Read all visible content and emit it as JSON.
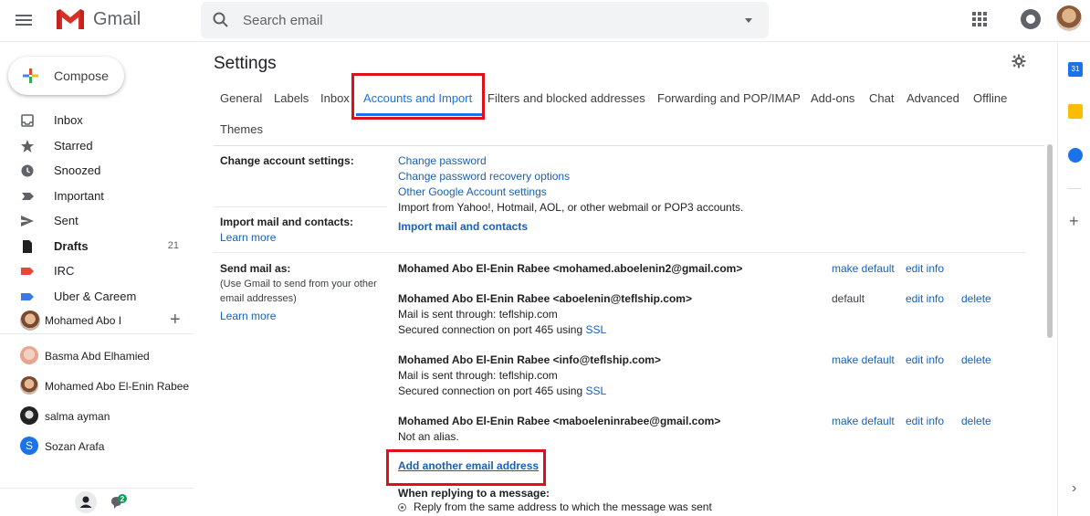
{
  "app": {
    "name": "Gmail"
  },
  "search": {
    "placeholder": "Search email"
  },
  "sidebar": {
    "compose_label": "Compose",
    "items": [
      {
        "label": "Inbox",
        "icon": "inbox-icon",
        "count": ""
      },
      {
        "label": "Starred",
        "icon": "star-icon",
        "count": ""
      },
      {
        "label": "Snoozed",
        "icon": "clock-icon",
        "count": ""
      },
      {
        "label": "Important",
        "icon": "important-icon",
        "count": ""
      },
      {
        "label": "Sent",
        "icon": "send-icon",
        "count": ""
      },
      {
        "label": "Drafts",
        "icon": "draft-icon",
        "count": "21"
      },
      {
        "label": "IRC",
        "icon": "label-red-icon",
        "count": ""
      },
      {
        "label": "Uber & Careem",
        "icon": "label-blue-icon",
        "count": ""
      }
    ],
    "hangouts_user": "Mohamed Abo I",
    "contacts": [
      {
        "name": "Basma Abd Elhamied"
      },
      {
        "name": "Mohamed Abo El-Enin Rabee"
      },
      {
        "name": "salma ayman"
      },
      {
        "name": "Sozan Arafa",
        "initial": "S"
      }
    ],
    "chat_badge": "2"
  },
  "settings": {
    "title": "Settings",
    "tabs": [
      "General",
      "Labels",
      "Inbox",
      "Accounts and Import",
      "Filters and blocked addresses",
      "Forwarding and POP/IMAP",
      "Add-ons",
      "Chat",
      "Advanced",
      "Offline"
    ],
    "active_tab": "Accounts and Import",
    "themes_tab": "Themes",
    "change_account": {
      "label": "Change account settings:",
      "links": [
        "Change password",
        "Change password recovery options",
        "Other Google Account settings"
      ],
      "import_note": "Import from Yahoo!, Hotmail, AOL, or other webmail or POP3 accounts."
    },
    "import_mail": {
      "label": "Import mail and contacts:",
      "learn_more": "Learn more",
      "action": "Import mail and contacts"
    },
    "send_mail_as": {
      "label": "Send mail as:",
      "sub": "(Use Gmail to send from your other email addresses)",
      "learn_more": "Learn more",
      "addresses": [
        {
          "address": "Mohamed Abo El-Enin Rabee <mohamed.aboelenin2@gmail.com>",
          "lines": [],
          "status": "make default",
          "edit": "edit info",
          "delete": ""
        },
        {
          "address": "Mohamed Abo El-Enin Rabee <aboelenin@teflship.com>",
          "lines": [
            "Mail is sent through: teflship.com",
            "Secured connection on port 465 using "
          ],
          "ssl": "SSL",
          "status": "default",
          "edit": "edit info",
          "delete": "delete"
        },
        {
          "address": "Mohamed Abo El-Enin Rabee <info@teflship.com>",
          "lines": [
            "Mail is sent through: teflship.com",
            "Secured connection on port 465 using "
          ],
          "ssl": "SSL",
          "status": "make default",
          "edit": "edit info",
          "delete": "delete"
        },
        {
          "address": "Mohamed Abo El-Enin Rabee <maboeleninrabee@gmail.com>",
          "lines": [
            "Not an alias."
          ],
          "status": "make default",
          "edit": "edit info",
          "delete": "delete"
        }
      ],
      "add_another": "Add another email address",
      "reply_heading": "When replying to a message:",
      "reply_option": "Reply from the same address to which the message was sent"
    }
  },
  "side_panel": {
    "calendar_day": "31"
  },
  "colors": {
    "highlight": "#e0101a",
    "link": "#1a5fb4",
    "accent": "#1a73e8"
  }
}
